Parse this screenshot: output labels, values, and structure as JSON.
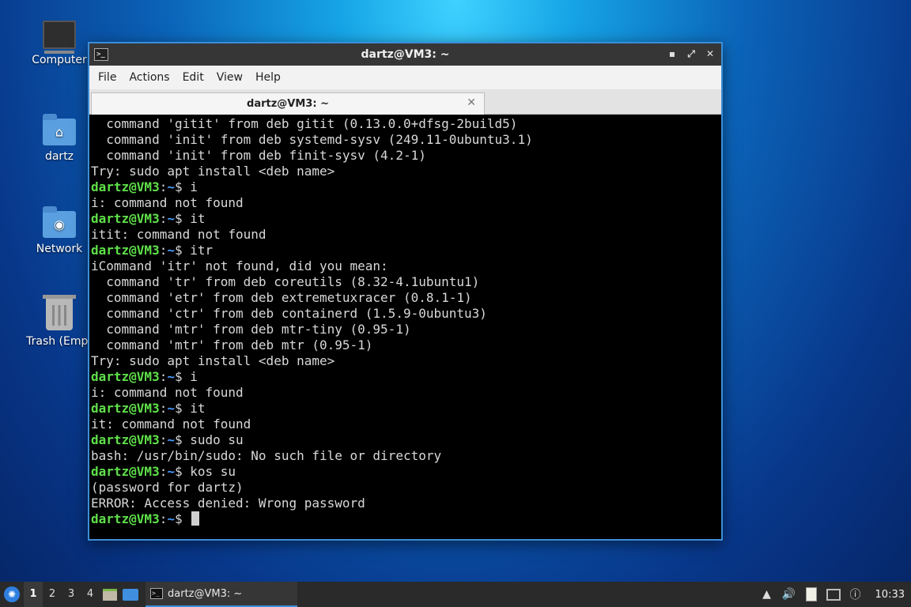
{
  "desktop": {
    "icons": [
      {
        "label": "Computer"
      },
      {
        "label": "dartz"
      },
      {
        "label": "Network"
      },
      {
        "label": "Trash (Empt"
      }
    ]
  },
  "window": {
    "title": "dartz@VM3: ~",
    "menu": [
      "File",
      "Actions",
      "Edit",
      "View",
      "Help"
    ],
    "tab_label": "dartz@VM3: ~",
    "prompt_user": "dartz@VM3",
    "prompt_sep": ":",
    "prompt_path": "~",
    "lines": [
      {
        "out": "  command 'gitit' from deb gitit (0.13.0.0+dfsg-2build5)"
      },
      {
        "out": "  command 'init' from deb systemd-sysv (249.11-0ubuntu3.1)"
      },
      {
        "out": "  command 'init' from deb finit-sysv (4.2-1)"
      },
      {
        "out": "Try: sudo apt install <deb name>"
      },
      {
        "cmd": "$ i"
      },
      {
        "out": "i: command not found"
      },
      {
        "cmd": "$ it"
      },
      {
        "out": "itit: command not found"
      },
      {
        "cmd": "$ itr"
      },
      {
        "out": "iCommand 'itr' not found, did you mean:"
      },
      {
        "out": "  command 'tr' from deb coreutils (8.32-4.1ubuntu1)"
      },
      {
        "out": "  command 'etr' from deb extremetuxracer (0.8.1-1)"
      },
      {
        "out": "  command 'ctr' from deb containerd (1.5.9-0ubuntu3)"
      },
      {
        "out": "  command 'mtr' from deb mtr-tiny (0.95-1)"
      },
      {
        "out": "  command 'mtr' from deb mtr (0.95-1)"
      },
      {
        "out": "Try: sudo apt install <deb name>"
      },
      {
        "cmd": "$ i"
      },
      {
        "out": "i: command not found"
      },
      {
        "cmd": "$ it"
      },
      {
        "out": "it: command not found"
      },
      {
        "cmd": "$ sudo su"
      },
      {
        "out": "bash: /usr/bin/sudo: No such file or directory"
      },
      {
        "cmd": "$ kos su"
      },
      {
        "out": "(password for dartz)"
      },
      {
        "out": "ERROR: Access denied: Wrong password"
      },
      {
        "cmd": "$ ",
        "cursor": true
      }
    ]
  },
  "taskbar": {
    "workspaces": [
      "1",
      "2",
      "3",
      "4"
    ],
    "active_workspace": "1",
    "task_label": "dartz@VM3: ~",
    "clock": "10:33"
  },
  "colors": {
    "prompt_user": "#5fe04a",
    "prompt_path": "#4a9bff",
    "window_border": "#3b8ed8"
  }
}
